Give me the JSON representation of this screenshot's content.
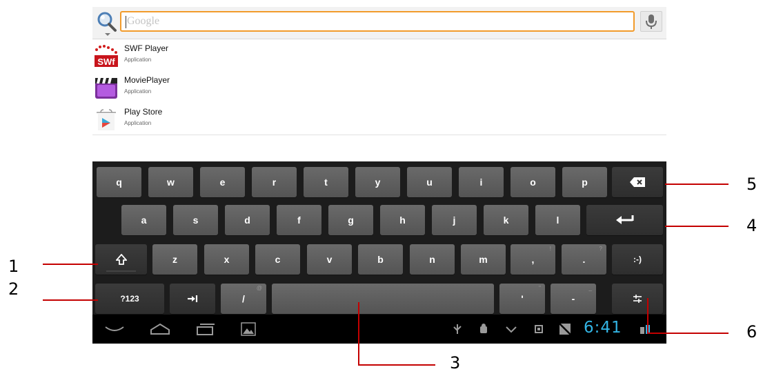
{
  "search": {
    "placeholder": "Google",
    "icon": "search-icon",
    "mic_icon": "microphone-icon"
  },
  "results": [
    {
      "name": "SWF Player",
      "type": "Application",
      "icon": "swf-player-icon"
    },
    {
      "name": "MoviePlayer",
      "type": "Application",
      "icon": "movie-player-icon"
    },
    {
      "name": "Play Store",
      "type": "Application",
      "icon": "play-store-icon"
    }
  ],
  "keyboard": {
    "row1": [
      "q",
      "w",
      "e",
      "r",
      "t",
      "y",
      "u",
      "i",
      "o",
      "p"
    ],
    "row2": [
      "a",
      "s",
      "d",
      "f",
      "g",
      "h",
      "j",
      "k",
      "l"
    ],
    "row3": [
      "z",
      "x",
      "c",
      "v",
      "b",
      "n",
      "m"
    ],
    "row3_punct": [
      {
        "label": ",",
        "hint": "!"
      },
      {
        "label": ".",
        "hint": "?"
      }
    ],
    "smiley_label": ":-)",
    "symbols_label": "?123",
    "slash_label": "/",
    "slash_hint": "@",
    "apostrophe_label": "'",
    "apostrophe_hint": "\"",
    "dash_label": "-",
    "dash_hint": "_",
    "backspace_icon": "backspace-icon",
    "enter_icon": "enter-icon",
    "shift_icon": "shift-icon",
    "tab_icon": "tab-icon",
    "settings_icon": "keyboard-settings-icon"
  },
  "navbar": {
    "clock": "6:41",
    "clock_color": "#33b5e5",
    "icons": [
      "back-icon",
      "home-icon",
      "recent-apps-icon",
      "screenshot-icon",
      "usb-icon",
      "android-debug-icon",
      "chevron-down-icon",
      "cpu-icon",
      "no-signal-icon",
      "wifi-icon"
    ]
  },
  "callouts": {
    "c1": "1",
    "c2": "2",
    "c3": "3",
    "c4": "4",
    "c5": "5",
    "c6": "6",
    "color": "#c40000"
  }
}
